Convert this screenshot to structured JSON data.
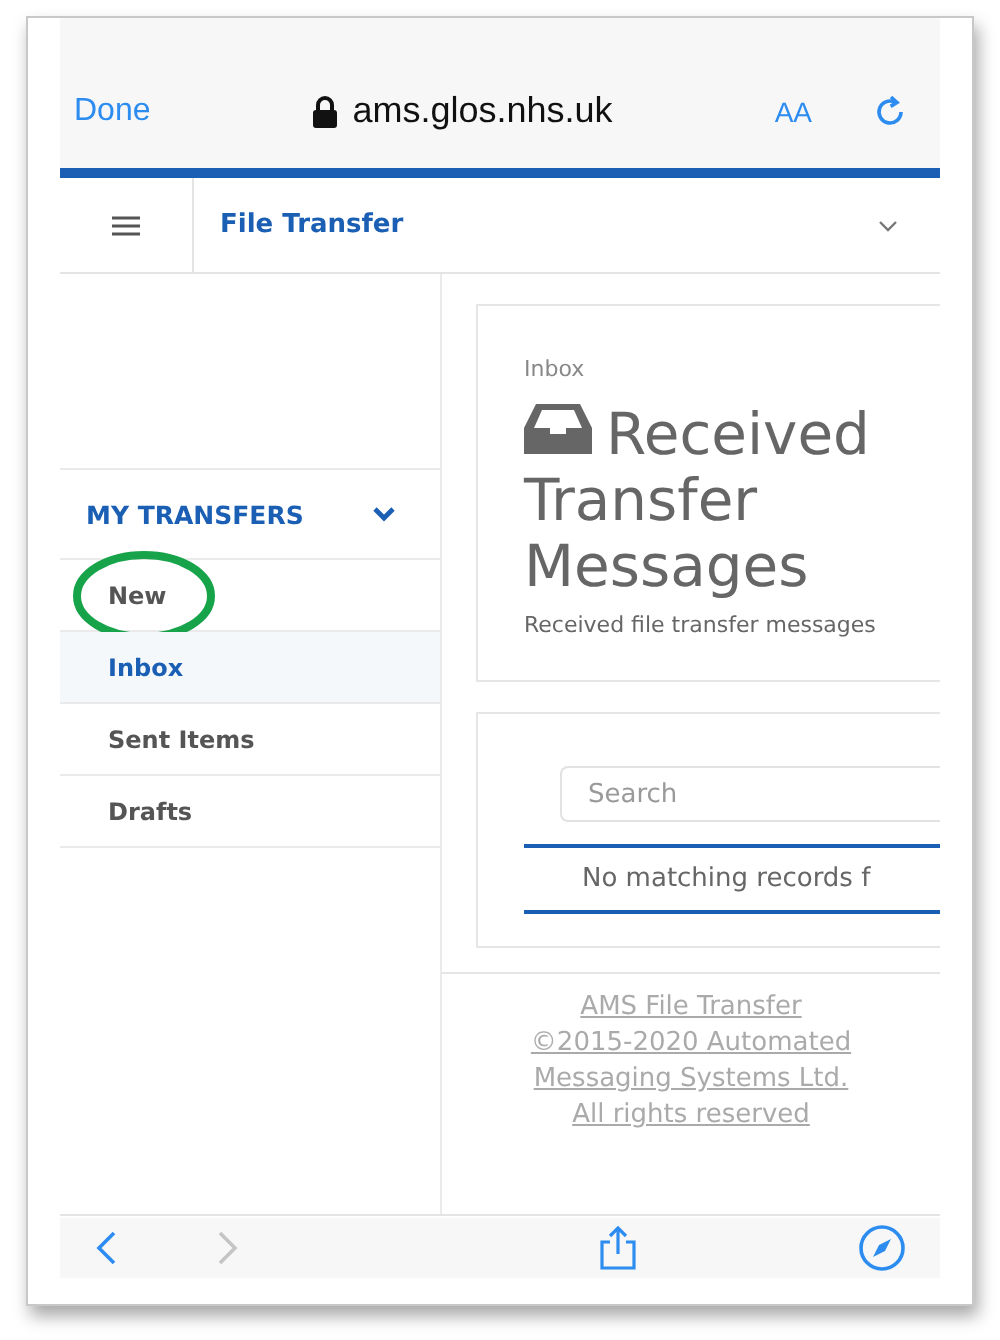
{
  "browser_bar": {
    "done": "Done",
    "url": "ams.glos.nhs.uk",
    "text_size": "AA"
  },
  "app_header": {
    "title": "File Transfer"
  },
  "sidebar": {
    "section": "MY TRANSFERS",
    "expanded": true,
    "items": [
      {
        "label": "New",
        "selected": false,
        "highlighted": true
      },
      {
        "label": "Inbox",
        "selected": true,
        "highlighted": false
      },
      {
        "label": "Sent Items",
        "selected": false,
        "highlighted": false
      },
      {
        "label": "Drafts",
        "selected": false,
        "highlighted": false
      }
    ]
  },
  "page_header": {
    "breadcrumb": "Inbox",
    "title": "Received Transfer Messages",
    "subtitle": "Received file transfer messages"
  },
  "search": {
    "placeholder": "Search"
  },
  "table": {
    "empty_message": "No matching records f"
  },
  "footer": {
    "text": "AMS File Transfer ©2015-2020 Automated Messaging Systems Ltd. All rights reserved"
  },
  "toolbar": {
    "back_disabled": false,
    "forward_disabled": true
  }
}
